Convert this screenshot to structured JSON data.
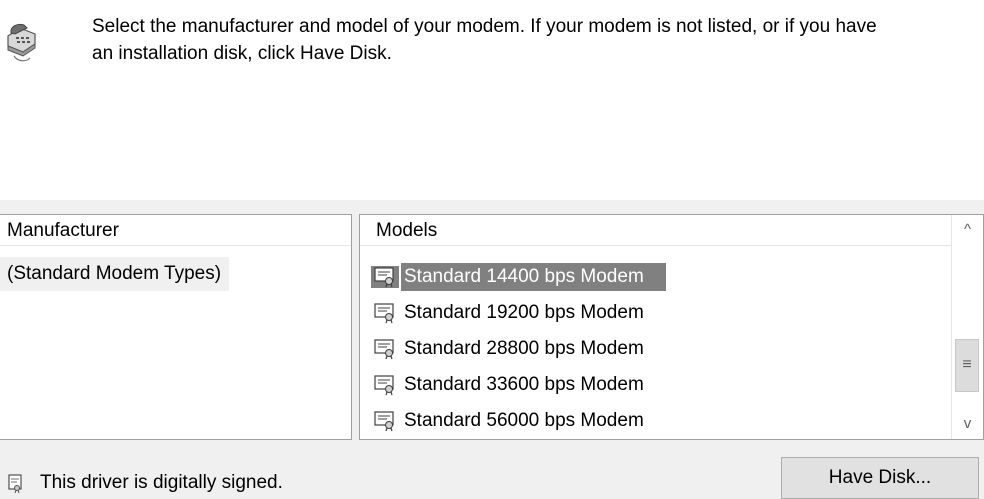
{
  "header": {
    "icon": "telephone-modem-icon",
    "instruction": "Select the manufacturer and model of your modem. If your modem is not listed, or if you have\nan installation disk, click Have Disk."
  },
  "manufacturer_list": {
    "header": "Manufacturer",
    "items": [
      "(Standard Modem Types)"
    ],
    "selected_index": 0
  },
  "models_list": {
    "header": "Models",
    "items": [
      "Standard 14400 bps Modem",
      "Standard 19200 bps Modem",
      "Standard 28800 bps Modem",
      "Standard 33600 bps Modem",
      "Standard 56000 bps Modem"
    ],
    "selected_index": 0,
    "item_icon": "certificate-icon",
    "scrollbar": {
      "up_glyph": "^",
      "thumb_glyph": "≡",
      "down_glyph": "v"
    }
  },
  "footer": {
    "signed_icon": "signed-certificate-icon",
    "signed_text": "This driver is digitally signed.",
    "have_disk_label": "Have Disk..."
  },
  "colors": {
    "selection": "#808080",
    "panel_background": "#f0f0f0",
    "button_background": "#e1e1e1"
  }
}
